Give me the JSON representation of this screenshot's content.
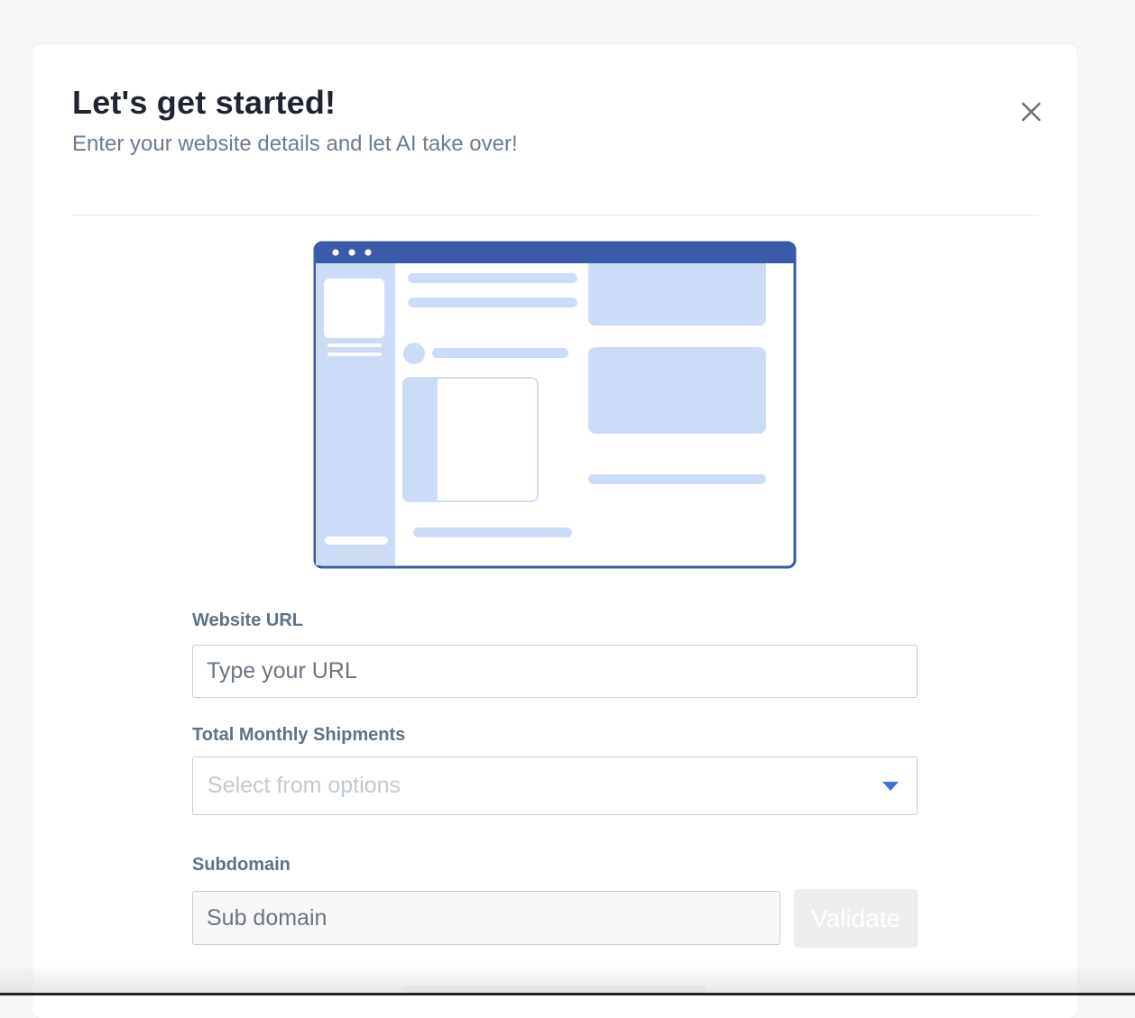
{
  "dialog": {
    "title": "Let's get started!",
    "subtitle": "Enter your website details and let AI take over!",
    "close_icon": "close-icon"
  },
  "illustration": {
    "icon": "website-illustration",
    "colors": {
      "frame": "#3a5ba8",
      "fill": "#cddcf6"
    }
  },
  "form": {
    "website_url": {
      "label": "Website URL",
      "placeholder": "Type your URL",
      "value": ""
    },
    "monthly_shipments": {
      "label": "Total Monthly Shipments",
      "placeholder": "Select from options",
      "caret_icon": "caret-down-icon"
    },
    "subdomain": {
      "label": "Subdomain",
      "placeholder": "Sub domain",
      "value": "",
      "validate_label": "Validate"
    }
  },
  "colors": {
    "accent": "#3f6fe0",
    "title": "#1f2430",
    "muted_text": "#6b7c8c",
    "label": "#5f7282"
  }
}
